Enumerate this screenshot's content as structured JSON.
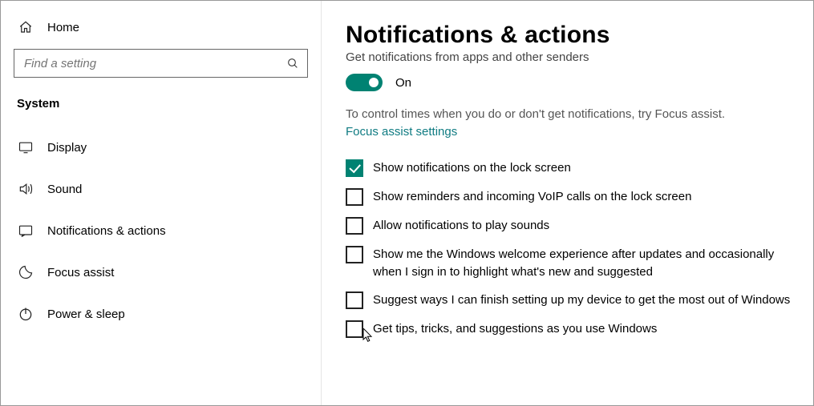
{
  "sidebar": {
    "home": "Home",
    "search_placeholder": "Find a setting",
    "group": "System",
    "items": [
      {
        "label": "Display"
      },
      {
        "label": "Sound"
      },
      {
        "label": "Notifications & actions"
      },
      {
        "label": "Focus assist"
      },
      {
        "label": "Power & sleep"
      }
    ]
  },
  "main": {
    "title": "Notifications & actions",
    "cutoff": "Get notifications from apps and other senders",
    "toggle_state": "On",
    "hint": "To control times when you do or don't get notifications, try Focus assist.",
    "link": "Focus assist settings",
    "options": [
      {
        "label": "Show notifications on the lock screen",
        "checked": true
      },
      {
        "label": "Show reminders and incoming VoIP calls on the lock screen",
        "checked": false
      },
      {
        "label": "Allow notifications to play sounds",
        "checked": false
      },
      {
        "label": "Show me the Windows welcome experience after updates and occasionally when I sign in to highlight what's new and suggested",
        "checked": false
      },
      {
        "label": "Suggest ways I can finish setting up my device to get the most out of Windows",
        "checked": false
      },
      {
        "label": "Get tips, tricks, and suggestions as you use Windows",
        "checked": false
      }
    ]
  }
}
